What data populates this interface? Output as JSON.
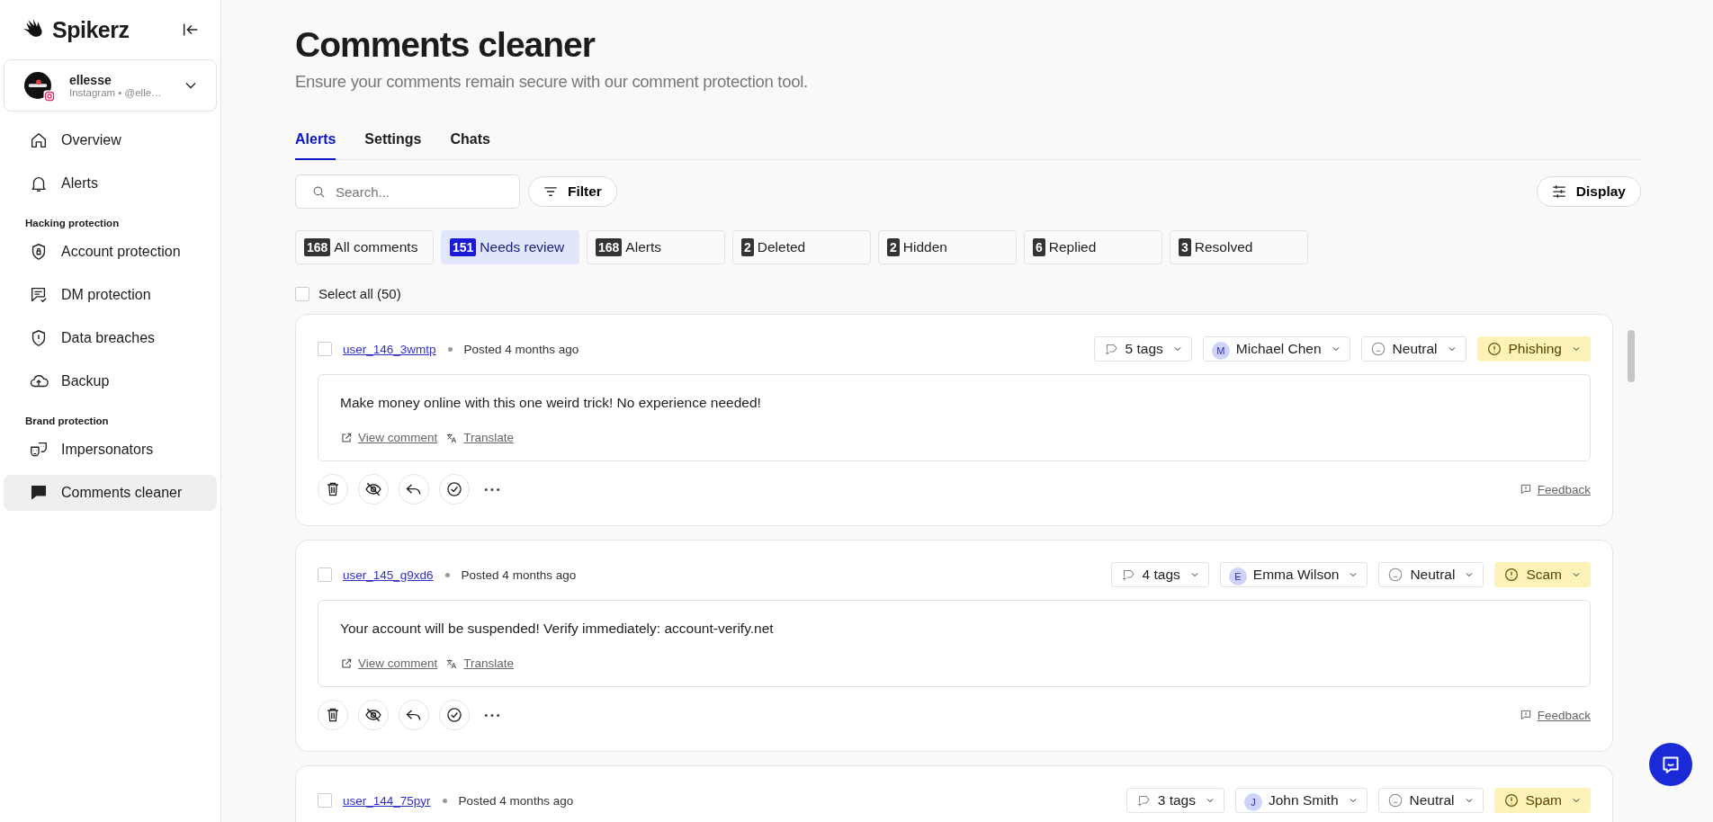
{
  "sidebar": {
    "logo": "Spikerz",
    "account": {
      "name": "ellesse",
      "subtitle": "Instagram • @elle…"
    },
    "sections": [
      {
        "items": [
          {
            "label": "Overview",
            "selected": false
          },
          {
            "label": "Alerts",
            "selected": false
          }
        ]
      },
      {
        "heading": "Hacking protection",
        "items": [
          {
            "label": "Account protection",
            "selected": false
          },
          {
            "label": "DM protection",
            "selected": false
          },
          {
            "label": "Data breaches",
            "selected": false
          },
          {
            "label": "Backup",
            "selected": false
          }
        ]
      },
      {
        "heading": "Brand protection",
        "items": [
          {
            "label": "Impersonators",
            "selected": false
          },
          {
            "label": "Comments cleaner",
            "selected": true
          }
        ]
      }
    ]
  },
  "title": "Comments cleaner",
  "subtitle": "Ensure your comments remain secure with our comment protection tool.",
  "tabs": [
    {
      "label": "Alerts",
      "selected": true
    },
    {
      "label": "Settings",
      "selected": false
    },
    {
      "label": "Chats",
      "selected": false
    }
  ],
  "search": {
    "placeholder": "Search..."
  },
  "filter": "Filter",
  "display": "Display",
  "counters": [
    {
      "count": "168",
      "label": "All comments",
      "selected": false
    },
    {
      "count": "151",
      "label": "Needs review",
      "selected": true
    },
    {
      "count": "168",
      "label": "Alerts",
      "selected": false
    },
    {
      "count": "2",
      "label": "Deleted",
      "selected": false
    },
    {
      "count": "2",
      "label": "Hidden",
      "selected": false
    },
    {
      "count": "6",
      "label": "Replied",
      "selected": false
    },
    {
      "count": "3",
      "label": "Resolved",
      "selected": false
    }
  ],
  "select_all": {
    "label": "Select all (50)",
    "checked": false
  },
  "comments": [
    {
      "checked": false,
      "username": "user_146_3wmtp",
      "posted": "Posted 4 months ago",
      "tags": "5 tags",
      "assignee": {
        "initial": "M",
        "name": "Michael Chen"
      },
      "sentiment": "Neutral",
      "category": "Phishing",
      "text": "Make money online with this one weird trick! No experience needed!",
      "view": "View comment",
      "translate": "Translate",
      "feedback": "Feedback"
    },
    {
      "checked": false,
      "username": "user_145_g9xd6",
      "posted": "Posted 4 months ago",
      "tags": "4 tags",
      "assignee": {
        "initial": "E",
        "name": "Emma Wilson"
      },
      "sentiment": "Neutral",
      "category": "Scam",
      "text": "Your account will be suspended! Verify immediately: account-verify.net",
      "view": "View comment",
      "translate": "Translate",
      "feedback": "Feedback"
    },
    {
      "checked": false,
      "username": "user_144_75pyr",
      "posted": "Posted 4 months ago",
      "tags": "3 tags",
      "assignee": {
        "initial": "J",
        "name": "John Smith"
      },
      "sentiment": "Neutral",
      "category": "Spam"
    }
  ]
}
